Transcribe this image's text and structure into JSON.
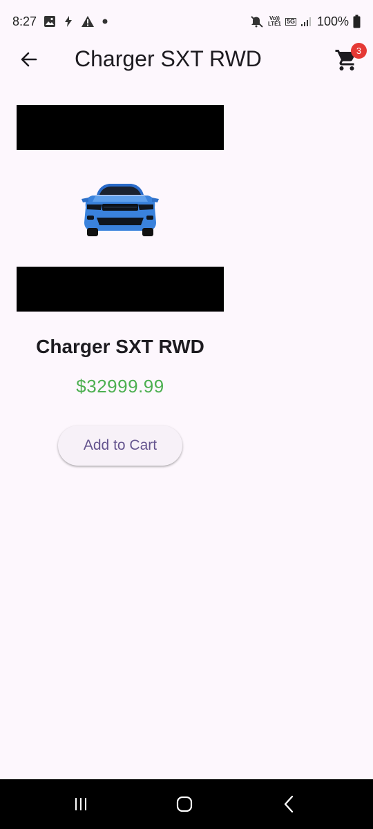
{
  "status_bar": {
    "time": "8:27",
    "left_icons": [
      "image-icon",
      "flash-icon",
      "warning-icon",
      "dot-icon"
    ],
    "volte_line1": "Vo))",
    "volte_line2": "LTE1",
    "network": "5G",
    "battery": "100%"
  },
  "app_bar": {
    "title": "Charger SXT RWD",
    "cart_count": "3"
  },
  "product": {
    "name": "Charger SXT RWD",
    "price": "$32999.99",
    "image_icon": "car-front-icon"
  },
  "actions": {
    "add_to_cart_label": "Add to Cart"
  },
  "colors": {
    "background": "#fdf7fd",
    "price": "#4caf50",
    "button_text": "#65558f",
    "badge": "#e53935"
  },
  "nav_bar": {
    "items": [
      "recent-apps-icon",
      "home-icon",
      "back-icon"
    ]
  }
}
